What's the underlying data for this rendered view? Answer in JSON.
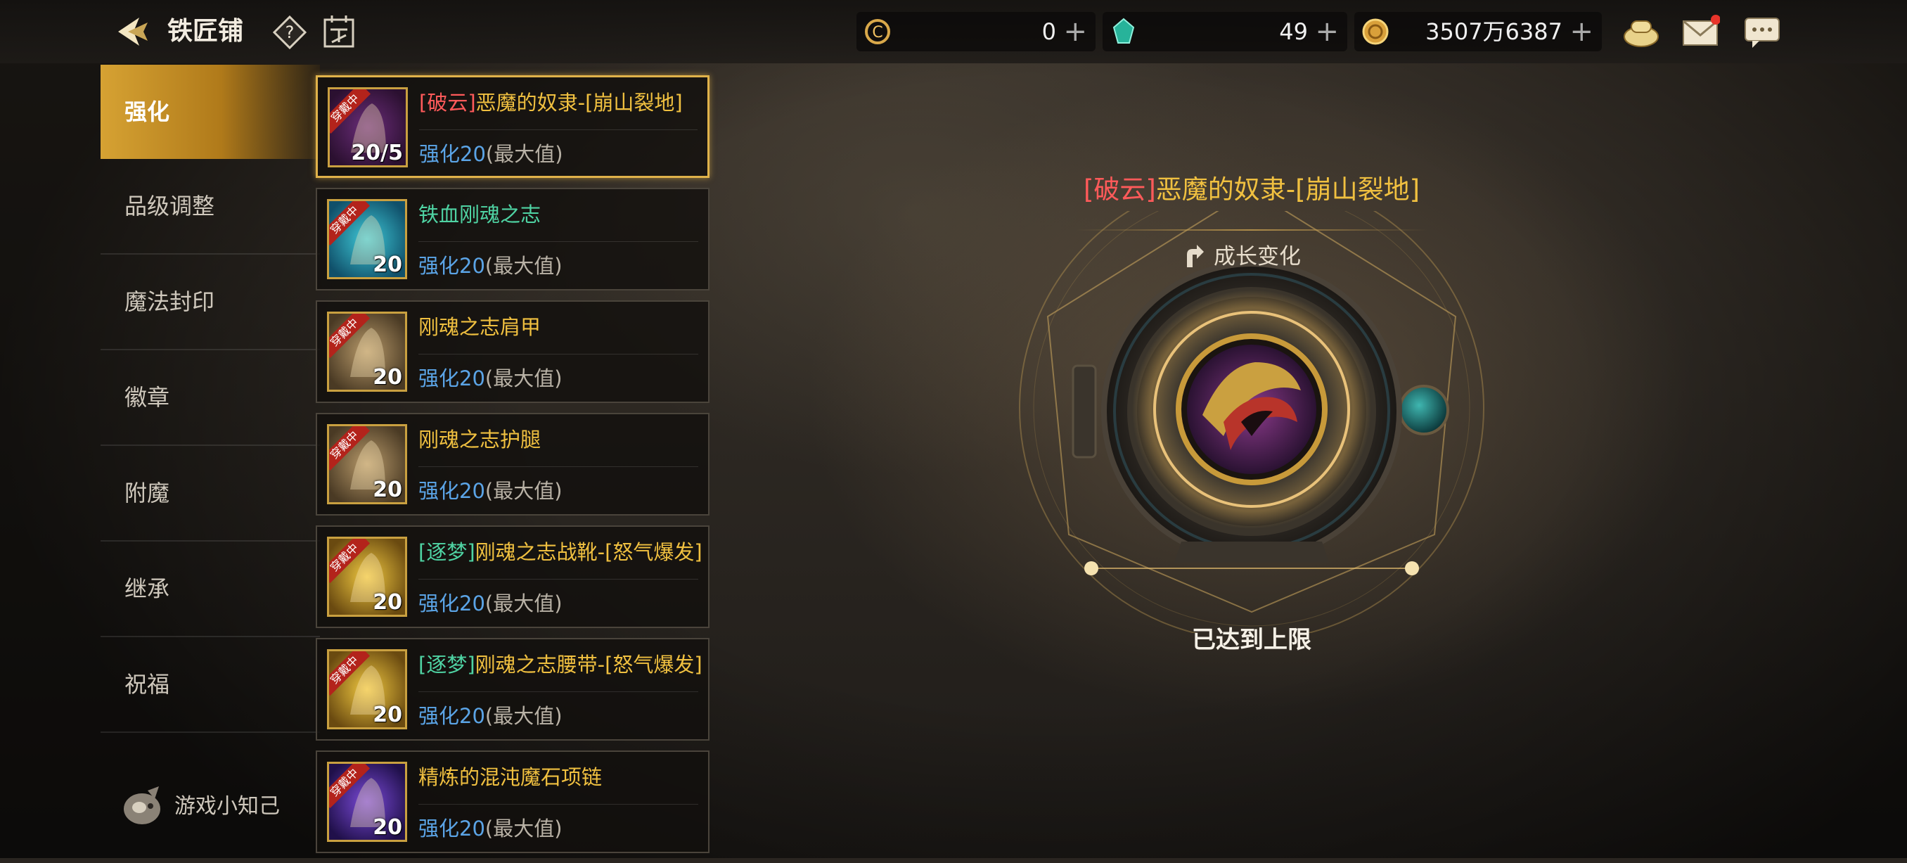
{
  "header": {
    "title": "铁匠铺",
    "back_icon": "back-arrow-icon",
    "help_icon": "question-icon",
    "calendar_icon": "calendar-icon"
  },
  "currencies": [
    {
      "name": "coin-c-icon",
      "value": "0"
    },
    {
      "name": "gem-icon",
      "value": "49"
    },
    {
      "name": "gold-coin-icon",
      "value": "3507万6387"
    }
  ],
  "top_icons": [
    "bag-icon",
    "mail-icon",
    "chat-icon"
  ],
  "nav": {
    "items": [
      "强化",
      "品级调整",
      "魔法封印",
      "徽章",
      "附魔",
      "继承",
      "祝福"
    ],
    "active_index": 0,
    "tips_label": "游戏小知己"
  },
  "items": [
    {
      "prefix": "[破云]",
      "name": "恶魔的奴隶-[崩山裂地]",
      "color": "red",
      "level_text": "强化20",
      "max_text": "(最大值)",
      "badge": "20/5",
      "ribbon": "穿戴中",
      "art": "purple"
    },
    {
      "prefix": "",
      "name": "铁血刚魂之志",
      "color": "green",
      "level_text": "强化20",
      "max_text": "(最大值)",
      "badge": "20",
      "ribbon": "穿戴中",
      "art": "cyan"
    },
    {
      "prefix": "",
      "name": "刚魂之志肩甲",
      "color": "gold",
      "level_text": "强化20",
      "max_text": "(最大值)",
      "badge": "20",
      "ribbon": "穿戴中",
      "art": "tan"
    },
    {
      "prefix": "",
      "name": "刚魂之志护腿",
      "color": "gold",
      "level_text": "强化20",
      "max_text": "(最大值)",
      "badge": "20",
      "ribbon": "穿戴中",
      "art": "tan"
    },
    {
      "prefix": "[逐梦]",
      "name": "刚魂之志战靴-[怒气爆发]",
      "color": "green",
      "level_text": "强化20",
      "max_text": "(最大值)",
      "badge": "20",
      "ribbon": "穿戴中",
      "art": "yellow"
    },
    {
      "prefix": "[逐梦]",
      "name": "刚魂之志腰带-[怒气爆发]",
      "color": "green",
      "level_text": "强化20",
      "max_text": "(最大值)",
      "badge": "20",
      "ribbon": "穿戴中",
      "art": "yellow"
    },
    {
      "prefix": "",
      "name": "精炼的混沌魔石项链",
      "color": "gold",
      "level_text": "强化20",
      "max_text": "(最大值)",
      "badge": "20",
      "ribbon": "穿戴中",
      "art": "violet"
    }
  ],
  "selected_index": 0,
  "detail": {
    "prefix": "[破云]",
    "name": "恶魔的奴隶-[崩山裂地]",
    "growth_label": "成长变化",
    "growth_icon": "growth-icon",
    "status": "已达到上限"
  },
  "colors": {
    "red": "#ff5a5a",
    "gold": "#f0c040",
    "green": "#4fd3a3",
    "level_blue": "#5ba4e6",
    "accent": "#d6a233"
  }
}
